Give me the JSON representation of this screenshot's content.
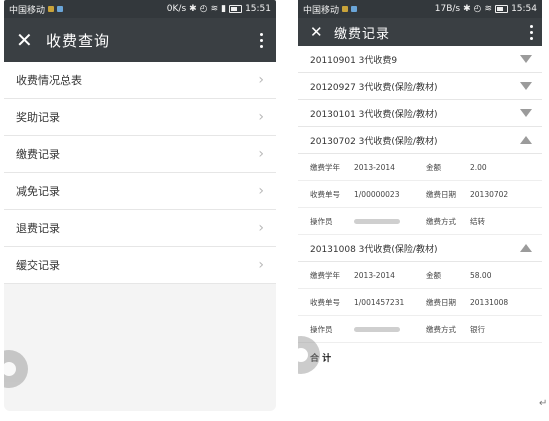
{
  "left": {
    "status": {
      "carrier": "中国移动",
      "speed": "0K/s",
      "time": "15:51"
    },
    "title": "收费查询",
    "items": [
      {
        "label": "收费情况总表"
      },
      {
        "label": "奖助记录"
      },
      {
        "label": "缴费记录"
      },
      {
        "label": "减免记录"
      },
      {
        "label": "退费记录"
      },
      {
        "label": "缓交记录"
      }
    ]
  },
  "right": {
    "status": {
      "carrier": "中国移动",
      "speed": "17B/s",
      "time": "15:54"
    },
    "title": "缴费记录",
    "records": [
      {
        "label": "20110901 3代收费9",
        "expanded": false
      },
      {
        "label": "20120927 3代收费(保险/教材)",
        "expanded": false
      },
      {
        "label": "20130101 3代收费(保险/教材)",
        "expanded": false
      },
      {
        "label": "20130702 3代收费(保险/教材)",
        "expanded": true,
        "details": {
          "r1": {
            "k1": "缴费学年",
            "v1": "2013-2014",
            "k2": "金额",
            "v2": "2.00"
          },
          "r2": {
            "k1": "收费单号",
            "v1": "1/00000023",
            "k2": "缴费日期",
            "v2": "20130702"
          },
          "r3": {
            "k1": "操作员",
            "v1": "",
            "k2": "缴费方式",
            "v2": "结转"
          }
        }
      },
      {
        "label": "20131008 3代收费(保险/教材)",
        "expanded": true,
        "details": {
          "r1": {
            "k1": "缴费学年",
            "v1": "2013-2014",
            "k2": "金额",
            "v2": "58.00"
          },
          "r2": {
            "k1": "收费单号",
            "v1": "1/001457231",
            "k2": "缴费日期",
            "v2": "20131008"
          },
          "r3": {
            "k1": "操作员",
            "v1": "",
            "k2": "缴费方式",
            "v2": "银行"
          }
        }
      }
    ],
    "total_label": "合 计"
  },
  "return_mark": "↵",
  "colors": {
    "toolbar": "#3a3f43",
    "statusbar": "#33383c",
    "divider": "#e6e6e6"
  }
}
